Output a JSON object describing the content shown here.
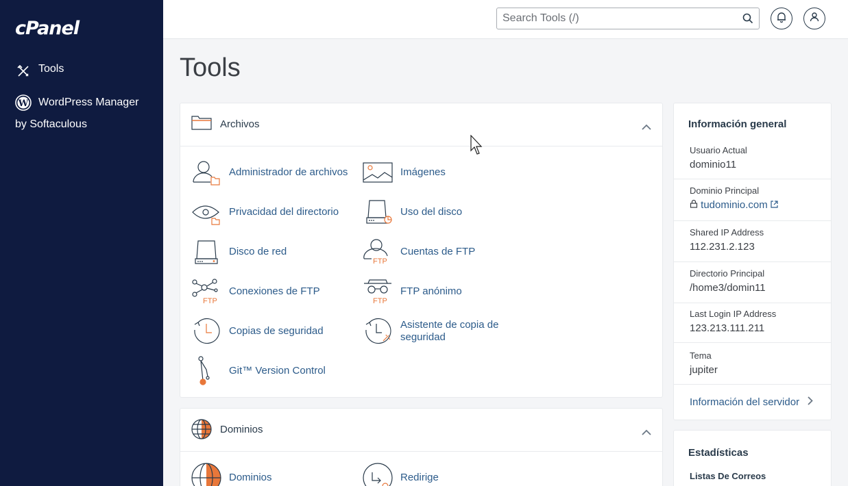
{
  "sidebar": {
    "logo": "cPanel",
    "items": [
      {
        "label": "Tools",
        "icon": "tools-icon"
      },
      {
        "label": "WordPress Manager",
        "label_line2": "by Softaculous",
        "icon": "wordpress-icon"
      }
    ]
  },
  "header": {
    "search_placeholder": "Search Tools (/)",
    "icons": [
      "search-icon",
      "bell-icon",
      "user-icon"
    ]
  },
  "page": {
    "title": "Tools"
  },
  "files_section": {
    "title": "Archivos",
    "tools": [
      {
        "label": "Administrador de archivos",
        "icon": "file-manager-icon"
      },
      {
        "label": "Imágenes",
        "icon": "images-icon"
      },
      {
        "label": "Privacidad del directorio",
        "icon": "directory-privacy-icon"
      },
      {
        "label": "Uso del disco",
        "icon": "disk-usage-icon"
      },
      {
        "label": "Disco de red",
        "icon": "network-disk-icon"
      },
      {
        "label": "Cuentas de FTP",
        "icon": "ftp-accounts-icon"
      },
      {
        "label": "Conexiones de FTP",
        "icon": "ftp-connections-icon"
      },
      {
        "label": "FTP anónimo",
        "icon": "anonymous-ftp-icon"
      },
      {
        "label": "Copias de seguridad",
        "icon": "backup-icon"
      },
      {
        "label": "Asistente de copia de seguridad",
        "icon": "backup-wizard-icon"
      },
      {
        "label": "Git™ Version Control",
        "icon": "git-icon"
      }
    ]
  },
  "domains_section": {
    "title": "Dominios",
    "tools": [
      {
        "label": "Dominios",
        "icon": "domains-icon"
      },
      {
        "label": "Redirige",
        "icon": "redirects-icon"
      }
    ]
  },
  "general_info": {
    "title": "Información general",
    "rows": [
      {
        "label": "Usuario Actual",
        "value": "dominio11"
      },
      {
        "label": "Dominio Principal",
        "value": "tudominio.com"
      },
      {
        "label": "Shared IP Address",
        "value": "112.231.2.123"
      },
      {
        "label": "Directorio Principal",
        "value": "/home3/domin11"
      },
      {
        "label": "Last Login IP Address",
        "value": "123.213.111.211"
      },
      {
        "label": "Tema",
        "value": "jupiter"
      }
    ],
    "server_link": "Información del servidor"
  },
  "stats": {
    "title": "Estadísticas",
    "first_item": "Listas De Correos"
  },
  "colors": {
    "sidebar_bg": "#0f1b40",
    "accent_orange": "#e8773a",
    "link_blue": "#2c5b8a"
  }
}
